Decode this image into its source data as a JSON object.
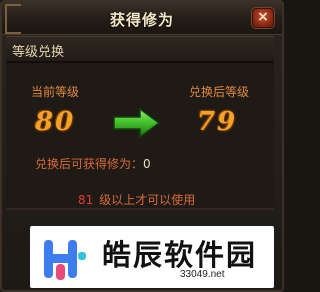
{
  "dialog": {
    "title": "获得修为",
    "close_icon": "close-icon",
    "close_glyph": "×"
  },
  "section": {
    "title": "等级兑换"
  },
  "exchange": {
    "current_label": "当前等级",
    "after_label": "兑换后等级",
    "current_level": "80",
    "after_level": "79",
    "arrow_icon": "right-arrow-icon",
    "gain_label": "兑换后可获得修为：",
    "gain_value": "0"
  },
  "requirement": {
    "level": "81",
    "text": "级以上才可以使用"
  },
  "watermark": {
    "text": "皓辰软件园",
    "url": "33049.net"
  },
  "colors": {
    "accent_orange": "#e08a3c",
    "level_gold": "#f2a22a",
    "arrow_green": "#3fbf2a",
    "warning_red": "#e03a2c"
  }
}
